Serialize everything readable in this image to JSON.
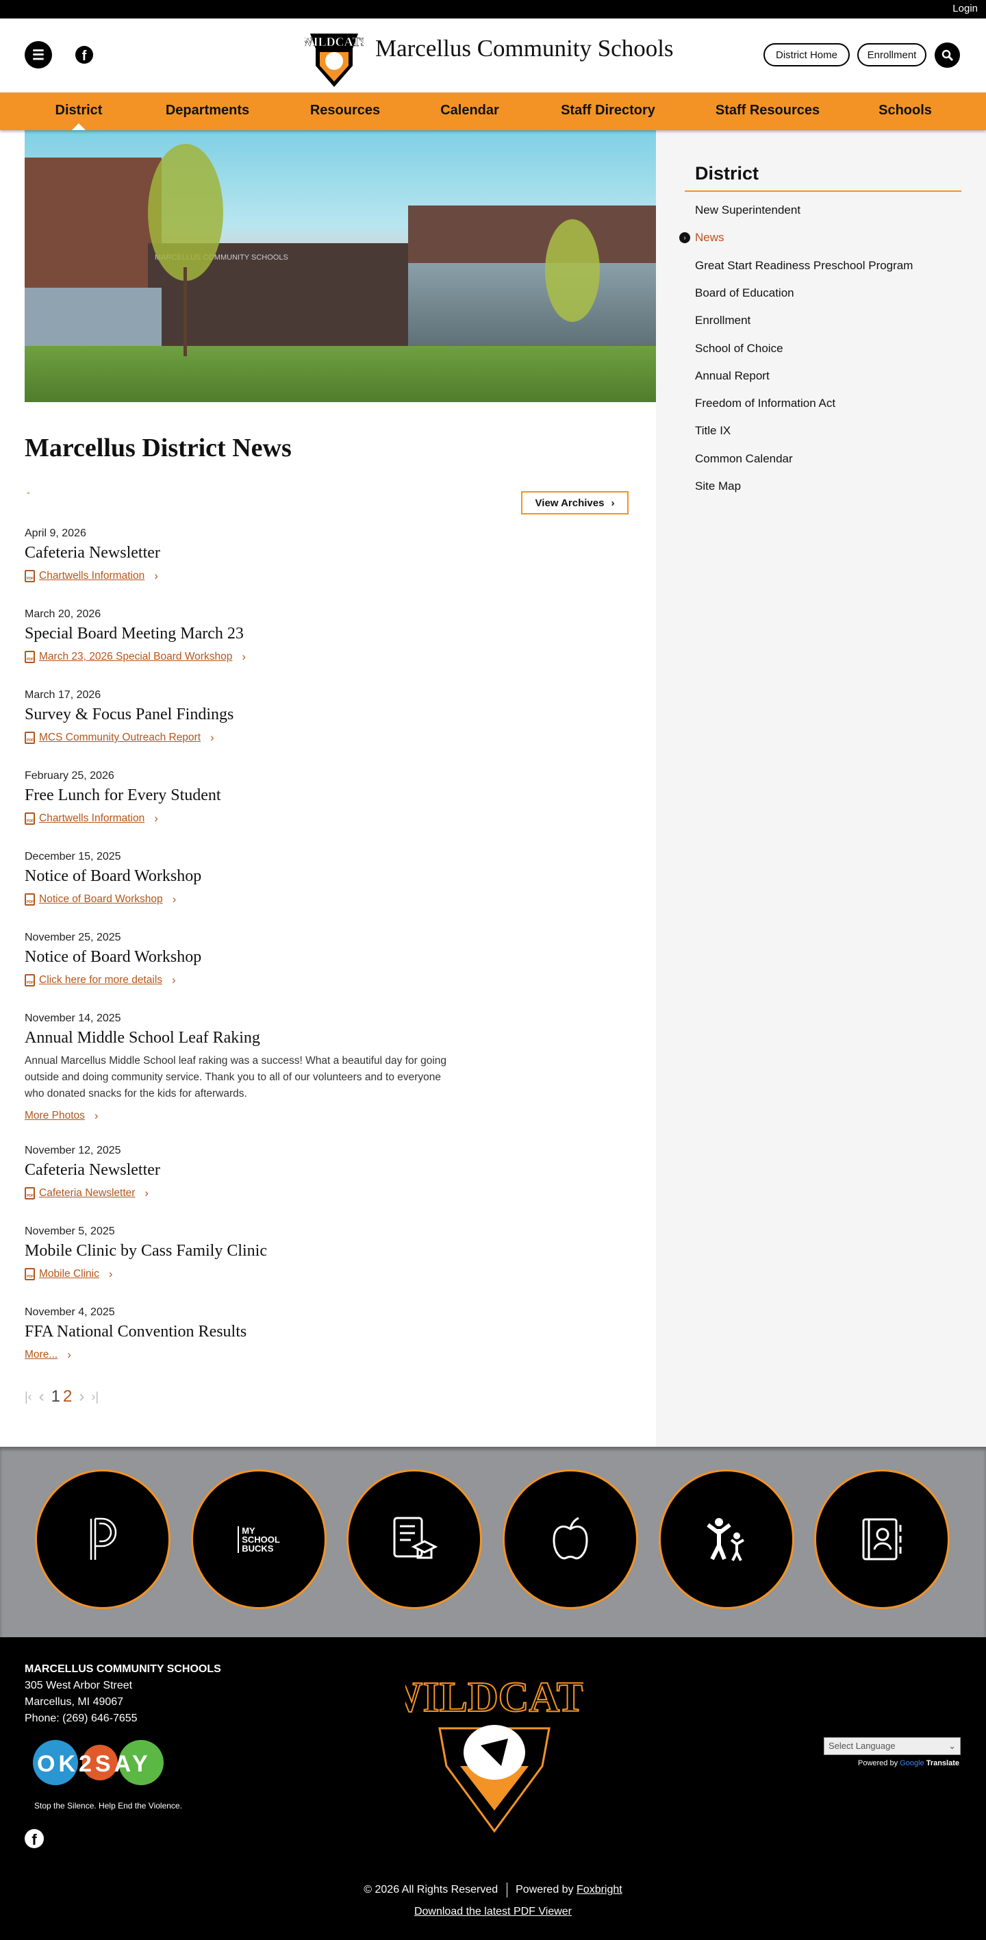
{
  "topbar": {
    "login": "Login"
  },
  "header": {
    "title": "Marcellus Community Schools",
    "logo_text": "WILDCATS",
    "buttons": [
      "District Home",
      "Enrollment"
    ]
  },
  "nav": {
    "items": [
      "District",
      "Departments",
      "Resources",
      "Calendar",
      "Staff Directory",
      "Staff Resources",
      "Schools"
    ],
    "active": "District"
  },
  "hero": {
    "building_sign": "MARCELLUS COMMUNITY SCHOOLS"
  },
  "main": {
    "title": "Marcellus District News",
    "view_archives": "View Archives",
    "news": [
      {
        "date": "April 9, 2026",
        "title": "Cafeteria Newsletter",
        "link": "Chartwells Information",
        "icon": "pdf-icon"
      },
      {
        "date": "March 20, 2026",
        "title": "Special Board Meeting March 23",
        "link": "March 23, 2026 Special Board Workshop",
        "icon": "pdf-icon"
      },
      {
        "date": "March 17, 2026",
        "title": "Survey & Focus Panel Findings",
        "link": "MCS Community Outreach Report",
        "icon": "pdf-icon"
      },
      {
        "date": "February 25, 2026",
        "title": "Free Lunch for Every Student",
        "link": "Chartwells Information",
        "icon": "pdf-icon"
      },
      {
        "date": "December 15, 2025",
        "title": "Notice of Board Workshop",
        "link": "Notice of Board Workshop",
        "icon": "pdf-icon"
      },
      {
        "date": "November 25, 2025",
        "title": "Notice of Board Workshop",
        "link": "Click here for more details",
        "icon": "pdf-icon"
      },
      {
        "date": "November 14, 2025",
        "title": "Annual Middle School Leaf Raking",
        "body": "Annual Marcellus Middle School leaf raking was a success! What a beautiful day for going outside and doing community service. Thank you to all of our volunteers and to everyone who donated snacks for the kids for afterwards.",
        "link": "More Photos"
      },
      {
        "date": "November 12, 2025",
        "title": "Cafeteria Newsletter",
        "link": "Cafeteria Newsletter",
        "icon": "pdf-icon"
      },
      {
        "date": "November 5, 2025",
        "title": "Mobile Clinic by Cass Family Clinic",
        "link": "Mobile Clinic",
        "icon": "doc-icon"
      },
      {
        "date": "November 4, 2025",
        "title": "FFA National Convention Results",
        "link": "More..."
      }
    ],
    "pagination": {
      "pages": [
        "1",
        "2"
      ],
      "current": "2"
    }
  },
  "sidebar": {
    "title": "District",
    "items": [
      "New Superintendent",
      "News",
      "Great Start Readiness Preschool Program",
      "Board of Education",
      "Enrollment",
      "School of Choice",
      "Annual Report",
      "Freedom of Information Act",
      "Title IX",
      "Common Calendar",
      "Site Map"
    ],
    "active": "News"
  },
  "quicklinks": [
    {
      "icon": "powerschool-icon"
    },
    {
      "icon": "myschoolbucks-icon",
      "text": [
        "MY",
        "SCHOOL",
        "BUCKS"
      ]
    },
    {
      "icon": "report-card-icon"
    },
    {
      "icon": "apple-icon"
    },
    {
      "icon": "parent-child-icon"
    },
    {
      "icon": "directory-icon"
    }
  ],
  "footer": {
    "org": "MARCELLUS COMMUNITY SCHOOLS",
    "address1": "305 West Arbor Street",
    "address2": "Marcellus, MI 49067",
    "phone": "Phone: (269) 646-7655",
    "ok2say": {
      "text": "OK2SAY",
      "tagline": "Stop the Silence. Help End the Violence."
    },
    "language": "Select Language",
    "powered_translate": "Powered by",
    "google": "Google",
    "translate": "Translate",
    "copyright": "© 2026 All Rights Reserved",
    "powered_by": "Powered by",
    "foxbright": "Foxbright",
    "pdf_viewer": "Download the latest PDF Viewer"
  },
  "colors": {
    "accent": "#F39325",
    "link": "#b5561c",
    "quicklinks_bg": "#939598",
    "sidebar_bg": "#f5f5f5"
  }
}
